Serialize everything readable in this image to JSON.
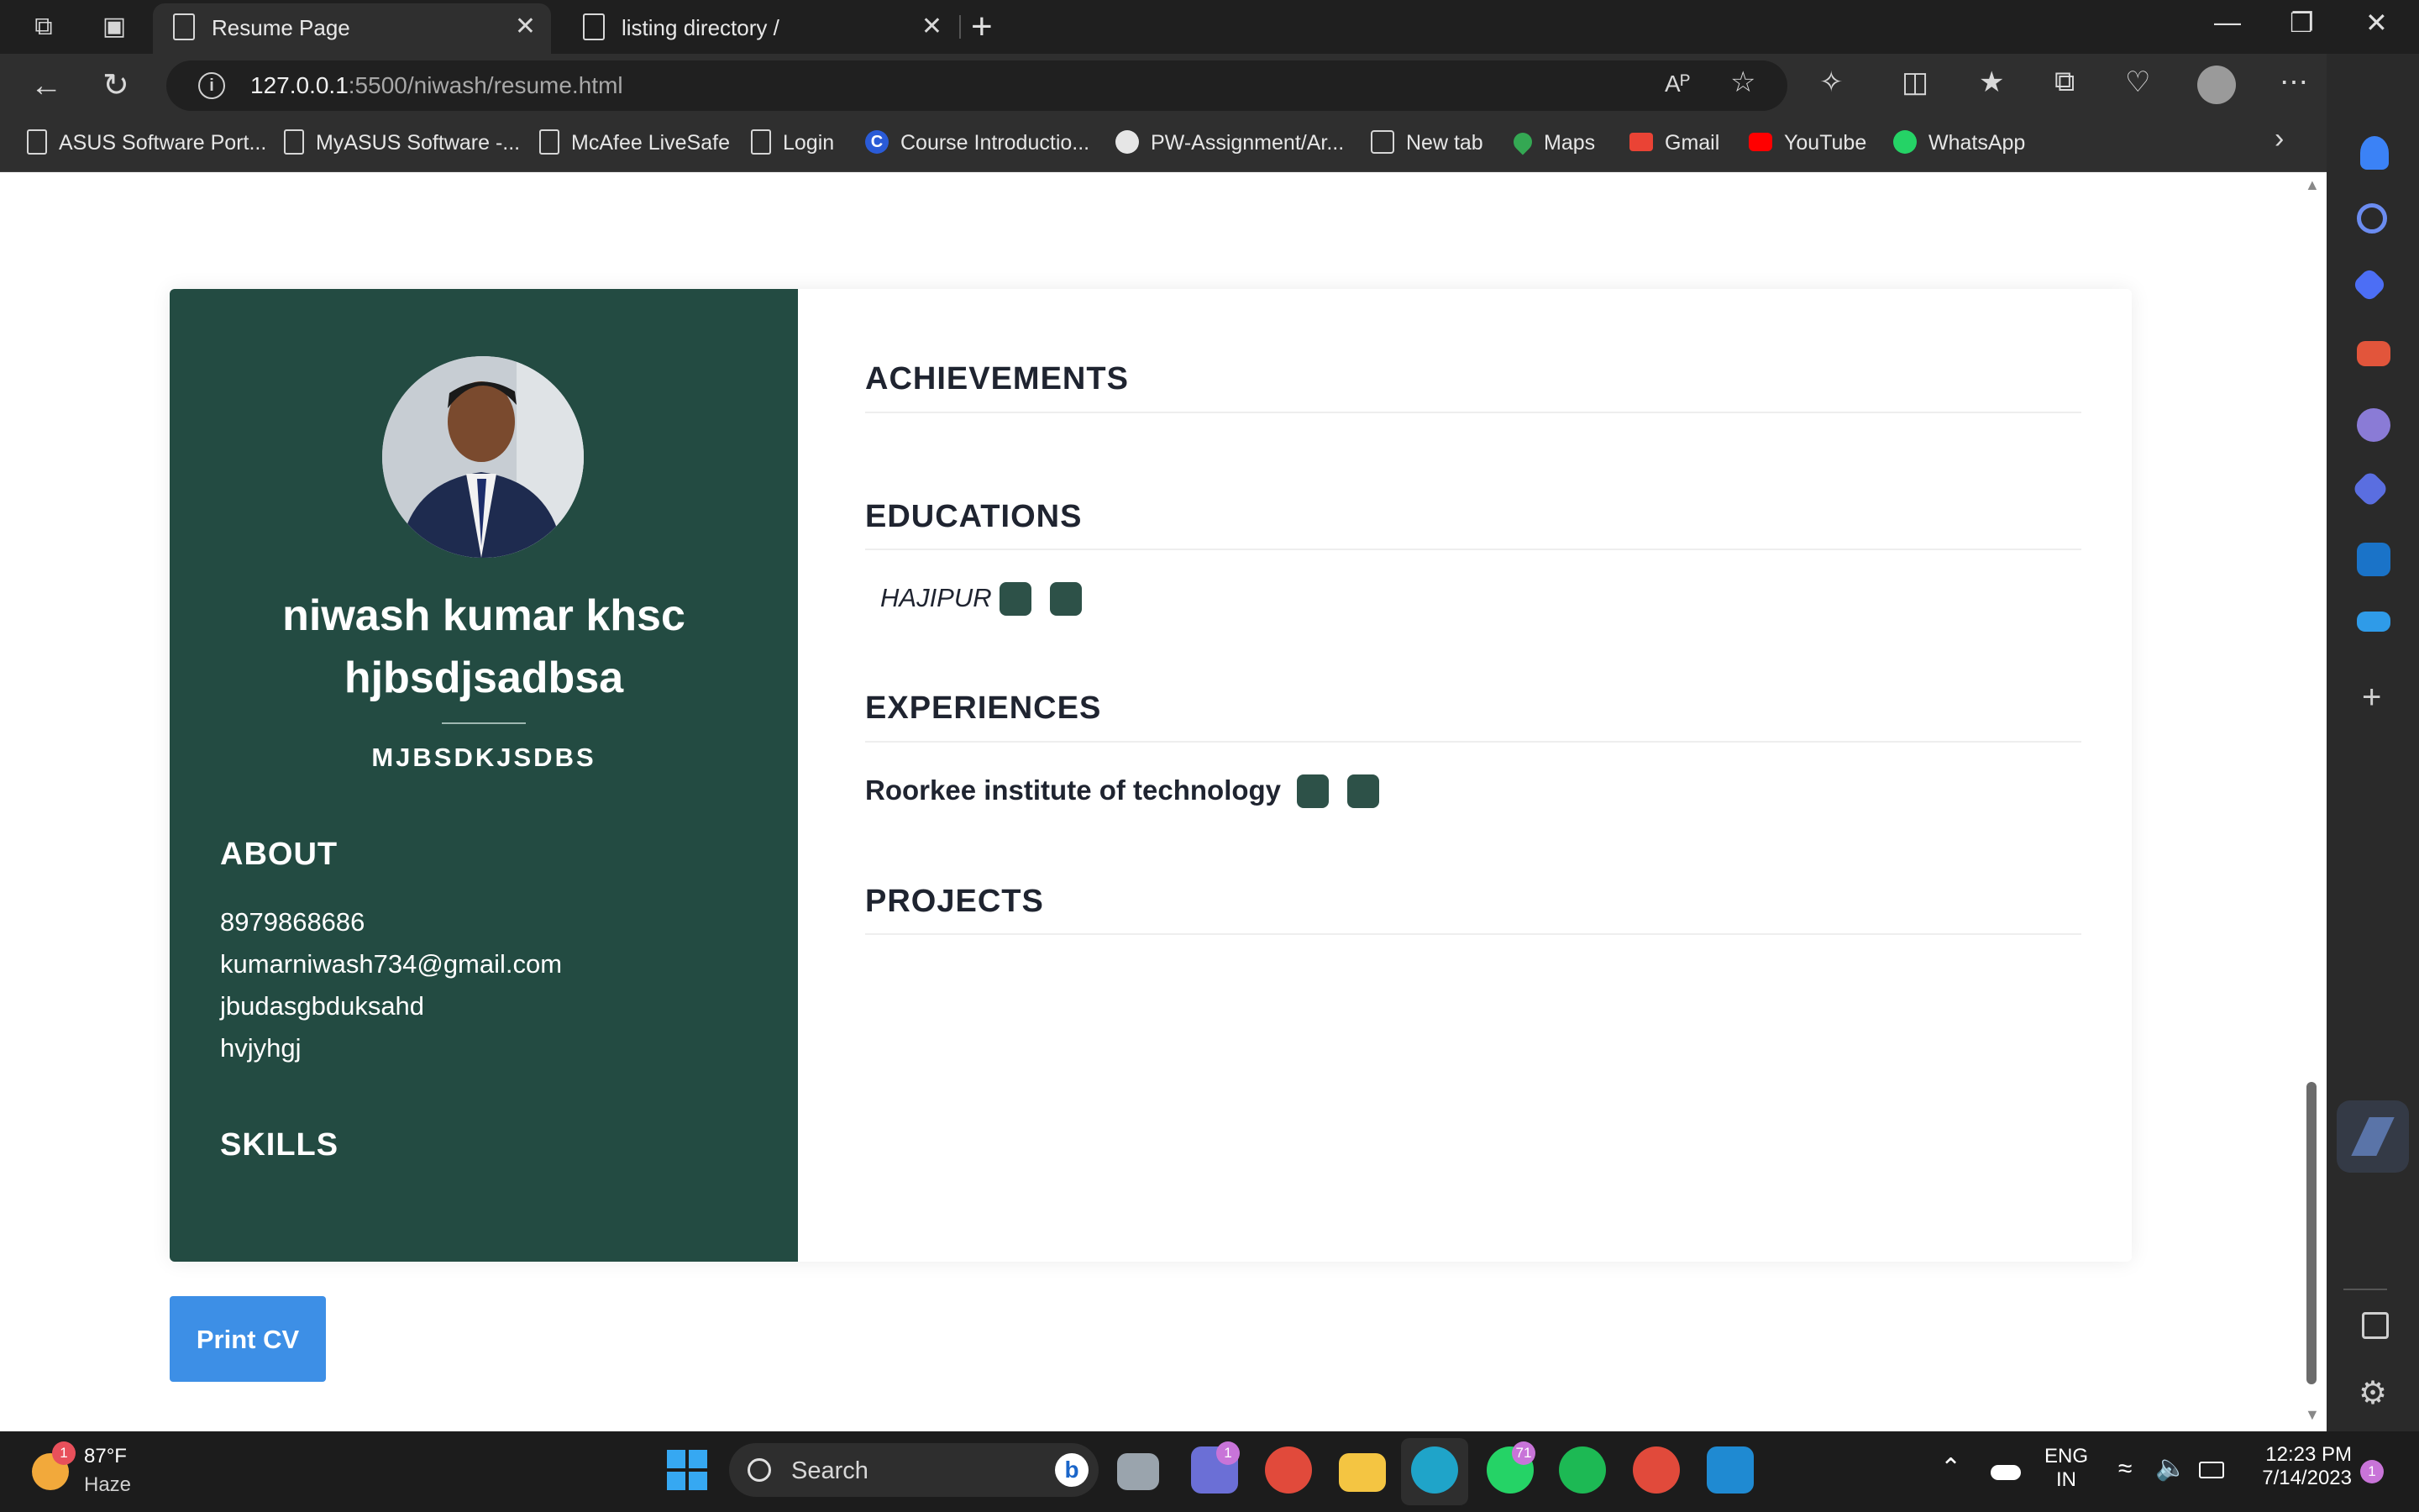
{
  "browser": {
    "tabs": [
      {
        "label": "Resume Page",
        "active": true
      },
      {
        "label": "listing directory /",
        "active": false
      }
    ],
    "new_tab_symbol": "+",
    "url_host": "127.0.0.1",
    "url_rest": ":5500/niwash/resume.html",
    "read_aloud_icon": "Aᴾ",
    "bookmarks": [
      {
        "label": "ASUS Software Port...",
        "icon": "document-icon"
      },
      {
        "label": "MyASUS Software -...",
        "icon": "document-icon"
      },
      {
        "label": "McAfee LiveSafe",
        "icon": "document-icon"
      },
      {
        "label": "Login",
        "icon": "document-icon"
      },
      {
        "label": "Course Introductio...",
        "icon": "coursera-icon"
      },
      {
        "label": "PW-Assignment/Ar...",
        "icon": "github-icon"
      },
      {
        "label": "New tab",
        "icon": "calendar-icon"
      },
      {
        "label": "Maps",
        "icon": "maps-icon"
      },
      {
        "label": "Gmail",
        "icon": "gmail-icon"
      },
      {
        "label": "YouTube",
        "icon": "youtube-icon"
      },
      {
        "label": "WhatsApp",
        "icon": "whatsapp-icon"
      }
    ]
  },
  "resume": {
    "name": "niwash kumar khsc hjbsdjsadbsa",
    "title": "MJBSDKJSDBS",
    "about_heading": "ABOUT",
    "about": [
      "8979868686",
      "kumarniwash734@gmail.com",
      "jbudasgbduksahd",
      "hvjyhgj"
    ],
    "skills_heading": "SKILLS",
    "achievements_heading": "ACHIEVEMENTS",
    "educations_heading": "EDUCATIONS",
    "education_entry": "HAJIPUR",
    "experiences_heading": "EXPERIENCES",
    "experience_entry": "Roorkee institute of technology",
    "projects_heading": "PROJECTS",
    "print_button": "Print CV"
  },
  "taskbar": {
    "weather_temp": "87°F",
    "weather_desc": "Haze",
    "weather_badge": "1",
    "search_label": "Search",
    "teams_badge": "1",
    "whatsapp_badge": "71",
    "lang_1": "ENG",
    "lang_2": "IN",
    "time": "12:23 PM",
    "date": "7/14/2023",
    "notification_count": "1"
  },
  "colors": {
    "left_panel": "#234b42",
    "accent_button": "#3d8fe6",
    "heading_text": "#1f2430"
  }
}
